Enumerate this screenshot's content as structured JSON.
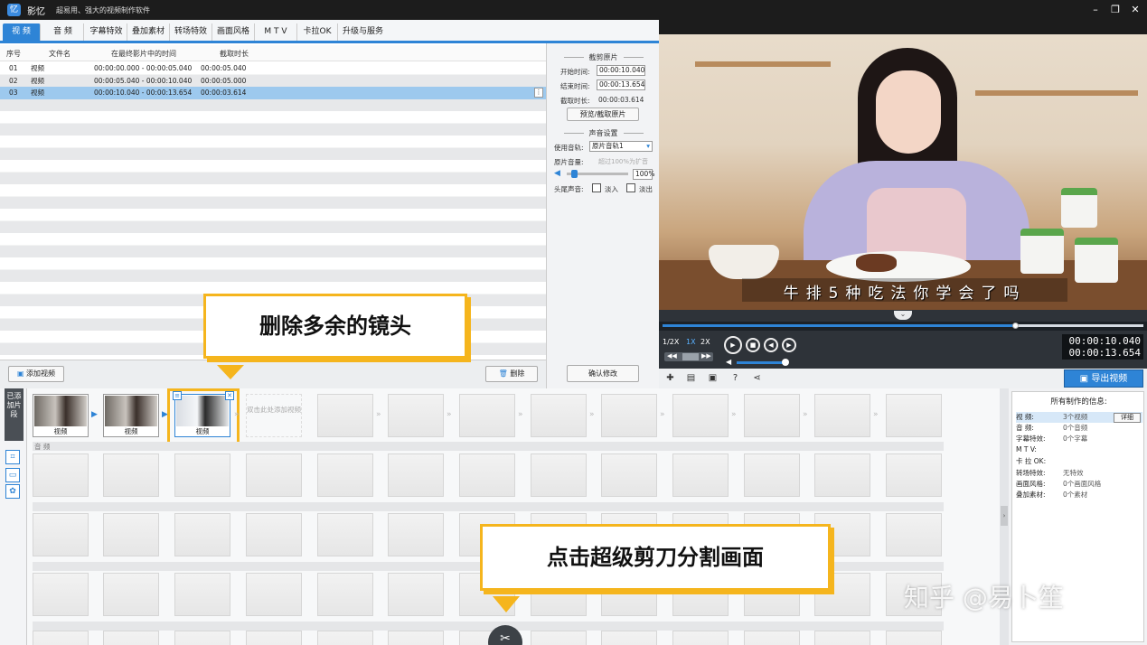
{
  "titlebar": {
    "logo": "忆",
    "app_name": "影忆",
    "slogan": "超易用、强大的视频制作软件",
    "minimize": "–",
    "restore": "❐",
    "close": "✕"
  },
  "menu": [
    {
      "label": "视 频"
    },
    {
      "label": "音 频"
    },
    {
      "label": "字幕特效"
    },
    {
      "label": "叠加素材"
    },
    {
      "label": "转场特效"
    },
    {
      "label": "画面风格"
    },
    {
      "label": "M T V"
    },
    {
      "label": "卡拉OK"
    },
    {
      "label": "升级与服务"
    }
  ],
  "table": {
    "headers": [
      "序号",
      "文件名",
      "在最终影片中的时间",
      "截取时长"
    ],
    "rows": [
      {
        "no": "01",
        "name": "视频",
        "range": "00:00:00.000 - 00:00:05.040",
        "dur": "00:00:05.040"
      },
      {
        "no": "02",
        "name": "视频",
        "range": "00:00:05.040 - 00:00:10.040",
        "dur": "00:00:05.000"
      },
      {
        "no": "03",
        "name": "视频",
        "range": "00:00:10.040 - 00:00:13.654",
        "dur": "00:00:03.614"
      }
    ],
    "selected_index": 2,
    "row_more": "⋮"
  },
  "left_actions": {
    "add_video": "添加视频",
    "delete": "删除"
  },
  "settings": {
    "clip_title": "截剪原片",
    "start_label": "开始时间:",
    "start_value": "00:00:10.040",
    "end_label": "结束时间:",
    "end_value": "00:00:13.654",
    "duration_label": "截取时长:",
    "duration_value": "00:00:03.614",
    "preview_btn": "预览/截取原片",
    "audio_title": "声音设置",
    "track_label": "使用音轨:",
    "track_value": "原片音轨1",
    "volume_label": "原片音量:",
    "volume_hint": "超过100%为扩音",
    "volume_value": "100%",
    "fade_label": "头尾声音:",
    "fade_in": "淡入",
    "fade_out": "淡出",
    "confirm_btn": "确认修改"
  },
  "video": {
    "subtitle": "牛排5种吃法你学会了吗",
    "expander": "⌄"
  },
  "player": {
    "speeds": [
      "1/2X",
      "1X",
      "2X"
    ],
    "active_speed": "1X",
    "current_time": "00:00:10.040",
    "total_time": "00:00:13.654",
    "progress": 0.735,
    "buttons": {
      "play": "▶",
      "stop": "■",
      "prev": "◀",
      "next": "▶"
    }
  },
  "toolbar": {
    "export": "导出视频",
    "export_icon": "▣"
  },
  "timeline": {
    "tab_label": "已添加片段",
    "clips": [
      {
        "label": "视频"
      },
      {
        "label": "视频"
      },
      {
        "label": "视频"
      }
    ],
    "add_here": "双击此处添加视频",
    "audio_label": "音 频",
    "arrow": "»",
    "scissors_icon": "✂"
  },
  "info": {
    "title": "所有制作的信息:",
    "rows": [
      {
        "k": "视    频:",
        "v": "3个视频"
      },
      {
        "k": "音    频:",
        "v": "0个音频"
      },
      {
        "k": "字幕特效:",
        "v": "0个字幕"
      },
      {
        "k": "M  T  V:",
        "v": ""
      },
      {
        "k": "卡 拉 OK:",
        "v": ""
      },
      {
        "k": "转场特效:",
        "v": "无特效"
      },
      {
        "k": "画面风格:",
        "v": "0个画面风格"
      },
      {
        "k": "叠加素材:",
        "v": "0个素材"
      }
    ],
    "detail_btn": "详细"
  },
  "callouts": {
    "delete_tip": "删除多余的镜头",
    "scissors_tip": "点击超级剪刀分割画面"
  },
  "watermark": "知乎 @易卜笙",
  "colors": {
    "accent": "#2e84d6",
    "callout": "#f5b51d",
    "selected_row": "#9dc9ee"
  }
}
